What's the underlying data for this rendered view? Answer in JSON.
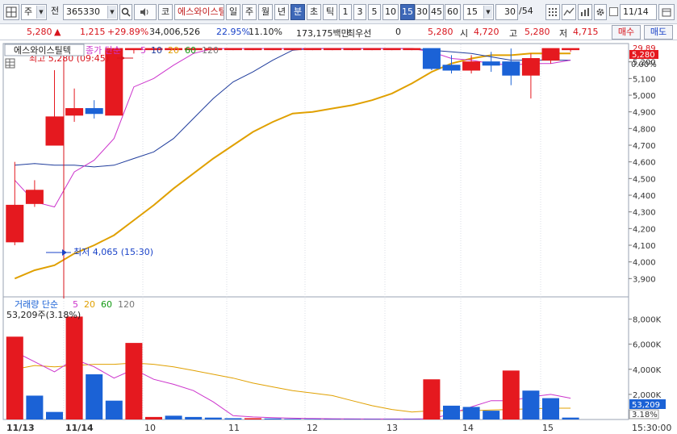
{
  "toolbar": {
    "market_type": "주",
    "prev_label": "전",
    "stock_code": "365330",
    "icon_code_label": "코",
    "company_name": "에스와이스틸텍",
    "period_tabs": [
      "일",
      "주",
      "월",
      "년",
      "분",
      "초",
      "틱"
    ],
    "minute_options": [
      "1",
      "3",
      "5",
      "10",
      "15",
      "30",
      "45",
      "60"
    ],
    "interval_value": "15",
    "count_value": "30",
    "count_total": "/54",
    "date_value": "11/14"
  },
  "quote": {
    "price": "5,280",
    "change": "1,215",
    "change_pct": "+29.89%",
    "volume": "34,006,526",
    "vol_ratio": "22.95%",
    "turnover": "11.10%",
    "amount": "173,175백만",
    "priority_label": "최우선",
    "priority_value": "0",
    "ask_price": "5,280",
    "open_label": "시",
    "open_value": "4,720",
    "high_label": "고",
    "high_value": "5,280",
    "low_label": "저",
    "low_value": "4,715",
    "buy_button": "매수",
    "sell_button": "매도"
  },
  "price_legend": {
    "name": "에스와이스틸텍",
    "series": "종가 단순",
    "ma": [
      "5",
      "10",
      "20",
      "60",
      "120"
    ],
    "high_note": "최고 5,280 (09:45)",
    "low_note": "최저 4,065 (15:30)",
    "right_top_pct": "29.89",
    "current_tag": "5,280",
    "right_zero": "0.00%"
  },
  "volume_legend": {
    "title": "거래량 단순",
    "ma": [
      "5",
      "20",
      "60",
      "120"
    ],
    "value": "53,209주(3.18%)",
    "current_tag": "53,209",
    "pct_tag": "3.18%"
  },
  "x_axis": {
    "labels": [
      "11/13",
      "11/14",
      "10",
      "11",
      "12",
      "13",
      "14",
      "15"
    ],
    "end_time": "15:30:00"
  },
  "colors": {
    "up": "#e5191f",
    "down": "#1b62d6",
    "ma5": "#cc33cc",
    "ma10": "#1f3c9c",
    "ma20": "#e0a000"
  },
  "chart_data": [
    {
      "type": "candlestick",
      "title": "에스와이스틸텍 종가 단순",
      "ylabel": "",
      "ylim": [
        3800,
        5300
      ],
      "y_ticks": [
        3900,
        4000,
        4100,
        4200,
        4300,
        4400,
        4500,
        4600,
        4700,
        4800,
        4900,
        5000,
        5100,
        5200
      ],
      "candles": [
        {
          "o": 4120,
          "h": 4600,
          "l": 4100,
          "c": 4340
        },
        {
          "o": 4350,
          "h": 4490,
          "l": 4330,
          "c": 4430
        },
        {
          "o": 4700,
          "h": 5150,
          "l": 4700,
          "c": 4870
        },
        {
          "o": 4880,
          "h": 5040,
          "l": 4840,
          "c": 4920
        },
        {
          "o": 4920,
          "h": 4970,
          "l": 4860,
          "c": 4890
        },
        {
          "o": 4880,
          "h": 5280,
          "l": 4880,
          "c": 5280
        },
        {
          "o": 5280,
          "h": 5280,
          "l": 5250,
          "c": 5280
        },
        {
          "o": 5280,
          "h": 5280,
          "l": 5270,
          "c": 5280
        },
        {
          "o": 5280,
          "h": 5280,
          "l": 5270,
          "c": 5280
        },
        {
          "o": 5280,
          "h": 5280,
          "l": 5270,
          "c": 5280
        },
        {
          "o": 5280,
          "h": 5280,
          "l": 5270,
          "c": 5280
        },
        {
          "o": 5280,
          "h": 5280,
          "l": 5270,
          "c": 5280
        },
        {
          "o": 5280,
          "h": 5280,
          "l": 5270,
          "c": 5280
        },
        {
          "o": 5280,
          "h": 5280,
          "l": 5270,
          "c": 5280
        },
        {
          "o": 5280,
          "h": 5280,
          "l": 5270,
          "c": 5280
        },
        {
          "o": 5280,
          "h": 5280,
          "l": 5270,
          "c": 5280
        },
        {
          "o": 5280,
          "h": 5280,
          "l": 5270,
          "c": 5280
        },
        {
          "o": 5280,
          "h": 5280,
          "l": 5270,
          "c": 5280
        },
        {
          "o": 5280,
          "h": 5280,
          "l": 5270,
          "c": 5280
        },
        {
          "o": 5280,
          "h": 5280,
          "l": 5270,
          "c": 5280
        },
        {
          "o": 5280,
          "h": 5280,
          "l": 5270,
          "c": 5280
        },
        {
          "o": 5280,
          "h": 5280,
          "l": 5150,
          "c": 5160
        },
        {
          "o": 5180,
          "h": 5240,
          "l": 5130,
          "c": 5150
        },
        {
          "o": 5150,
          "h": 5240,
          "l": 5130,
          "c": 5200
        },
        {
          "o": 5200,
          "h": 5260,
          "l": 5140,
          "c": 5180
        },
        {
          "o": 5200,
          "h": 5280,
          "l": 5060,
          "c": 5120
        },
        {
          "o": 5120,
          "h": 5250,
          "l": 4980,
          "c": 5220
        },
        {
          "o": 5210,
          "h": 5280,
          "l": 5190,
          "c": 5280
        },
        {
          "o": 5280,
          "h": 5280,
          "l": 5260,
          "c": 5280
        }
      ],
      "ma5": [
        4490,
        4360,
        4330,
        4540,
        4610,
        4740,
        5050,
        5100,
        5180,
        5250,
        5280,
        5280,
        5280,
        5280,
        5280,
        5280,
        5280,
        5280,
        5280,
        5280,
        5280,
        5260,
        5220,
        5210,
        5190,
        5180,
        5190,
        5190,
        5210
      ],
      "ma10": [
        4580,
        4590,
        4580,
        4580,
        4570,
        4580,
        4620,
        4660,
        4740,
        4860,
        4980,
        5080,
        5140,
        5210,
        5270,
        5280,
        5280,
        5280,
        5280,
        5280,
        5280,
        5270,
        5260,
        5250,
        5230,
        5210,
        5210,
        5210,
        5210
      ],
      "ma20": [
        3900,
        3950,
        3980,
        4050,
        4100,
        4160,
        4250,
        4340,
        4440,
        4530,
        4620,
        4700,
        4780,
        4840,
        4890,
        4900,
        4920,
        4940,
        4970,
        5010,
        5070,
        5140,
        5190,
        5220,
        5240,
        5240,
        5250,
        5250,
        5250
      ]
    },
    {
      "type": "bar",
      "title": "거래량 단순",
      "ylabel": "",
      "ylim": [
        0,
        9000
      ],
      "y_ticks": [
        2000,
        4000,
        6000,
        8000
      ],
      "values": [
        6600,
        1900,
        600,
        8200,
        3600,
        1500,
        6100,
        200,
        300,
        200,
        150,
        100,
        100,
        80,
        50,
        40,
        30,
        30,
        30,
        30,
        30,
        3200,
        1100,
        1000,
        700,
        3900,
        2300,
        1700,
        150
      ],
      "up": [
        1,
        0,
        0,
        1,
        0,
        0,
        1,
        1,
        0,
        0,
        0,
        0,
        1,
        0,
        0,
        0,
        0,
        0,
        0,
        0,
        0,
        1,
        0,
        0,
        0,
        1,
        0,
        0,
        0
      ],
      "ma5": [
        5400,
        4600,
        3800,
        4800,
        4200,
        3300,
        4000,
        3200,
        2800,
        2300,
        1400,
        300,
        200,
        150,
        100,
        80,
        60,
        50,
        40,
        40,
        40,
        60,
        450,
        1000,
        1500,
        1500,
        1800,
        2000,
        1700
      ],
      "ma20": [
        4000,
        4300,
        4200,
        4300,
        4400,
        4400,
        4500,
        4400,
        4200,
        3900,
        3600,
        3300,
        2900,
        2600,
        2300,
        2100,
        1900,
        1500,
        1100,
        800,
        600,
        700,
        700,
        700,
        750,
        800,
        850,
        900,
        900
      ]
    }
  ]
}
